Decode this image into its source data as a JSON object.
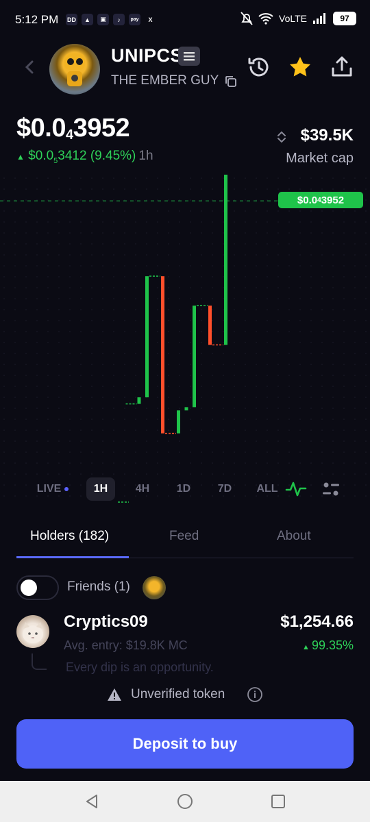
{
  "status_bar": {
    "time": "5:12 PM",
    "app_icons": [
      "dd-app-icon",
      "flag-app-icon",
      "tracker-app-icon",
      "tiktok-icon",
      "paytm-icon",
      "x-icon"
    ],
    "app_glyphs": [
      "DD",
      "▲",
      "▣",
      "♪",
      "pay",
      "X"
    ],
    "network": "VoLTE",
    "battery": "97"
  },
  "header": {
    "token_name": "UNIPCS",
    "creator": "THE EMBER GUY"
  },
  "price": {
    "prefix": "$0.0",
    "zeros": "4",
    "digits": "3952",
    "change_prefix": "$0.0",
    "change_zeros": "5",
    "change_digits": "3412",
    "change_pct": "(9.45%)",
    "timeframe": "1h"
  },
  "market_cap": {
    "value": "$39.5K",
    "label": "Market cap"
  },
  "chart_data": {
    "type": "candlestick",
    "current_price_tag": {
      "prefix": "$0.0",
      "zeros": "4",
      "digits": "3952"
    },
    "y_units": "relative price level",
    "candles": [
      {
        "open": 0.0,
        "high": 0.0,
        "low": 0.0,
        "close": 0.0,
        "color": "green"
      },
      {
        "open": 0.3,
        "high": 0.3,
        "low": -0.3,
        "close": 0.3,
        "color": "green"
      },
      {
        "open": 0.3,
        "high": 0.3,
        "low": 0.3,
        "close": 0.32,
        "color": "green"
      },
      {
        "open": 0.32,
        "high": 0.69,
        "low": 0.32,
        "close": 0.69,
        "color": "green"
      },
      {
        "open": 0.69,
        "high": 0.69,
        "low": 0.69,
        "close": 0.69,
        "color": "green"
      },
      {
        "open": 0.69,
        "high": 0.69,
        "low": 0.21,
        "close": 0.21,
        "color": "red"
      },
      {
        "open": 0.21,
        "high": 0.21,
        "low": 0.21,
        "close": 0.21,
        "color": "red"
      },
      {
        "open": 0.21,
        "high": 0.28,
        "low": 0.21,
        "close": 0.28,
        "color": "green"
      },
      {
        "open": 0.28,
        "high": 0.28,
        "low": 0.28,
        "close": 0.29,
        "color": "green"
      },
      {
        "open": 0.29,
        "high": 0.6,
        "low": 0.29,
        "close": 0.6,
        "color": "green"
      },
      {
        "open": 0.6,
        "high": 0.6,
        "low": 0.6,
        "close": 0.6,
        "color": "green"
      },
      {
        "open": 0.6,
        "high": 0.6,
        "low": 0.48,
        "close": 0.48,
        "color": "red"
      },
      {
        "open": 0.48,
        "high": 0.48,
        "low": 0.48,
        "close": 0.48,
        "color": "red"
      },
      {
        "open": 0.48,
        "high": 1.0,
        "low": 0.48,
        "close": 1.0,
        "color": "green"
      }
    ],
    "current_level": 0.92,
    "colors": {
      "up": "#1fc34a",
      "down": "#ff4f2b",
      "grid": "#1e1e2c",
      "price_line": "#1fc34a"
    }
  },
  "timeframes": {
    "live": "LIVE",
    "items": [
      "1H",
      "4H",
      "1D",
      "7D",
      "ALL"
    ],
    "active": "1H"
  },
  "tabs": {
    "holders": "Holders (182)",
    "feed": "Feed",
    "about": "About"
  },
  "friends": {
    "label": "Friends (1)",
    "toggle_on": false
  },
  "holder": {
    "name": "Cryptics09",
    "entry": "Avg. entry: $19.8K MC",
    "value": "$1,254.66",
    "change": "99.35%",
    "note": "Every dip is an opportunity."
  },
  "warning": {
    "label": "Unverified token"
  },
  "cta": {
    "label": "Deposit to buy"
  },
  "colors": {
    "background": "#0b0b14",
    "accent": "#4f62f7",
    "positive": "#2ed158",
    "negative": "#ff4f2b"
  }
}
